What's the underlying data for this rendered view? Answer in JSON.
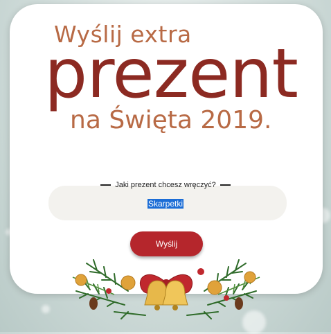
{
  "header": {
    "line1": "Wyślij extra",
    "line2": "prezent",
    "line3": "na Święta 2019."
  },
  "form": {
    "question_label": "Jaki prezent chcesz wręczyć?",
    "gift_value": "Skarpetki",
    "submit_label": "Wyślij"
  },
  "colors": {
    "title_accent": "#b86a45",
    "title_main": "#8c2a22",
    "button": "#b5262c",
    "selection": "#1b6dd6"
  }
}
